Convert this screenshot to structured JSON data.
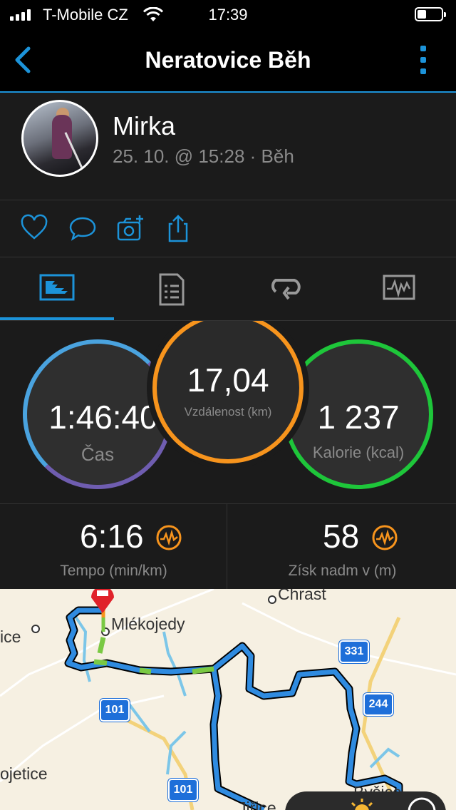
{
  "status": {
    "carrier": "T-Mobile CZ",
    "time": "17:39"
  },
  "nav": {
    "title": "Neratovice Běh"
  },
  "profile": {
    "name": "Mirka",
    "meta": "25. 10. @ 15:28 · Běh"
  },
  "metrics": {
    "time": {
      "value": "1:46:40",
      "label": "Čas",
      "color": "#4aa3df"
    },
    "distance": {
      "value": "17,04",
      "label": "Vzdálenost (km)",
      "color": "#f7941d"
    },
    "calories": {
      "value": "1 237",
      "label": "Kalorie (kcal)",
      "color": "#1ec63a"
    }
  },
  "stats": [
    {
      "value": "6:16",
      "label": "Tempo (min/km)",
      "icon": "chart-wave-icon"
    },
    {
      "value": "58",
      "label": "Získ nadm v (m)",
      "icon": "chart-wave-icon"
    }
  ],
  "map": {
    "labels": [
      "Chrast",
      "Mlékojedy",
      "ice",
      "ojetice",
      "Jiřice",
      "Byšice"
    ],
    "shields": [
      "331",
      "244",
      "101",
      "101"
    ]
  },
  "colors": {
    "accent": "#1c93d9",
    "orange": "#f7941d"
  }
}
